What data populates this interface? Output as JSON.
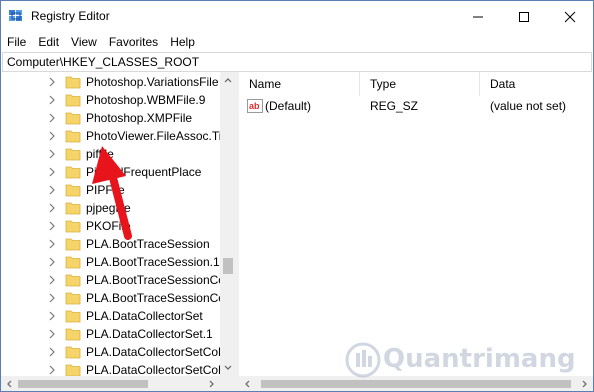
{
  "window": {
    "title": "Registry Editor",
    "controls": {
      "minimize": "minimize",
      "maximize": "maximize",
      "close": "close"
    }
  },
  "menu": {
    "items": [
      {
        "label": "File"
      },
      {
        "label": "Edit"
      },
      {
        "label": "View"
      },
      {
        "label": "Favorites"
      },
      {
        "label": "Help"
      }
    ]
  },
  "address": {
    "path": "Computer\\HKEY_CLASSES_ROOT"
  },
  "tree": {
    "items": [
      {
        "label": "Photoshop.VariationsFile"
      },
      {
        "label": "Photoshop.WBMFile.9"
      },
      {
        "label": "Photoshop.XMPFile"
      },
      {
        "label": "PhotoViewer.FileAssoc.Tif"
      },
      {
        "label": "piffile"
      },
      {
        "label": "PinnedFrequentPlace"
      },
      {
        "label": "PIPFile"
      },
      {
        "label": "pjpegfile"
      },
      {
        "label": "PKOFile"
      },
      {
        "label": "PLA.BootTraceSession"
      },
      {
        "label": "PLA.BootTraceSession.1"
      },
      {
        "label": "PLA.BootTraceSessionColl"
      },
      {
        "label": "PLA.BootTraceSessionColl"
      },
      {
        "label": "PLA.DataCollectorSet"
      },
      {
        "label": "PLA.DataCollectorSet.1"
      },
      {
        "label": "PLA.DataCollectorSetColl"
      },
      {
        "label": "PLA.DataCollectorSetColl"
      }
    ]
  },
  "values": {
    "columns": {
      "name": "Name",
      "type": "Type",
      "data": "Data"
    },
    "rows": [
      {
        "name": "(Default)",
        "type": "REG_SZ",
        "data": "(value not set)"
      }
    ]
  },
  "annotation": {
    "color": "#e8141c"
  },
  "watermark": {
    "text": "Quantrimang"
  },
  "colors": {
    "folder": "#f5d56a",
    "folder_edge": "#d9b13c",
    "ab_icon": "#d9302b"
  }
}
